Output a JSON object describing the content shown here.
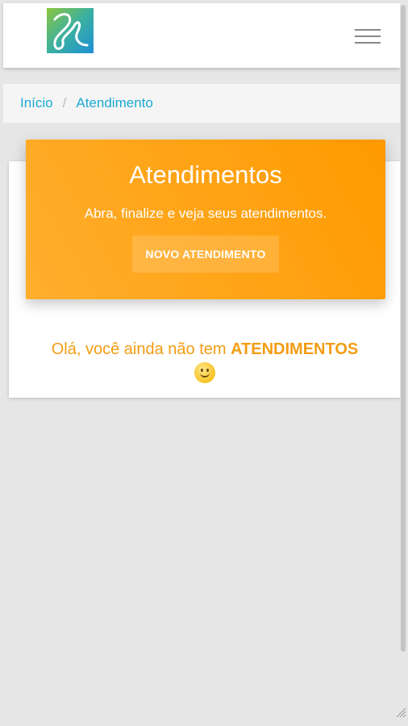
{
  "header": {
    "logo_alt": "logo",
    "menu_icon": "hamburger-menu-icon"
  },
  "breadcrumb": {
    "home_label": "Início",
    "separator": "/",
    "current_label": "Atendimento"
  },
  "hero": {
    "title": "Atendimentos",
    "subtitle": "Abra, finalize e veja seus atendimentos.",
    "button_label": "NOVO ATENDIMENTO"
  },
  "empty_state": {
    "text_prefix": "Olá, você ainda não tem ",
    "text_highlight": "ATENDIMENTOS",
    "emoji_icon": "smiley-icon"
  },
  "colors": {
    "accent_orange": "#ff9a00",
    "link_blue": "#1ba9d4",
    "message_orange": "#f39c12"
  }
}
